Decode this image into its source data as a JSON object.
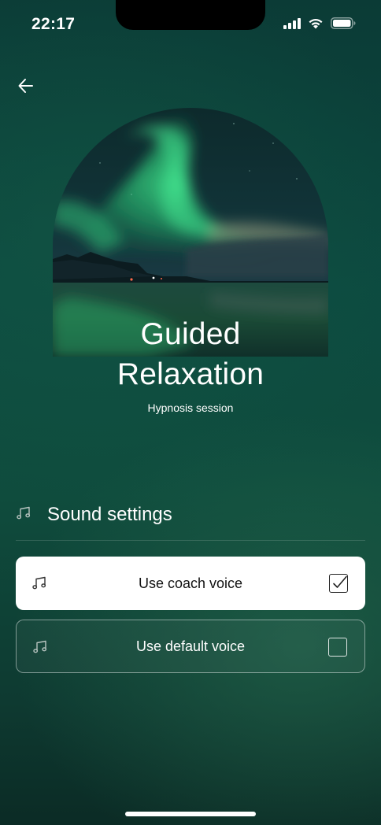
{
  "status_bar": {
    "time": "22:17",
    "icons": [
      "cellular-signal-icon",
      "wifi-icon",
      "battery-icon"
    ]
  },
  "nav": {
    "back_icon": "arrow-left-icon"
  },
  "hero": {
    "image": "aurora-over-lake-photo",
    "title_line1": "Guided",
    "title_line2": "Relaxation",
    "subtitle": "Hypnosis session"
  },
  "sound_settings": {
    "icon": "music-note-icon",
    "title": "Sound settings",
    "options": [
      {
        "label": "Use coach voice",
        "icon": "music-note-icon",
        "checked": true
      },
      {
        "label": "Use default voice",
        "icon": "music-note-icon",
        "checked": false
      }
    ]
  },
  "colors": {
    "background_top": "#0b3b36",
    "background_mid": "#0f4c3d",
    "selected_option_bg": "#ffffff",
    "text": "#ffffff"
  }
}
